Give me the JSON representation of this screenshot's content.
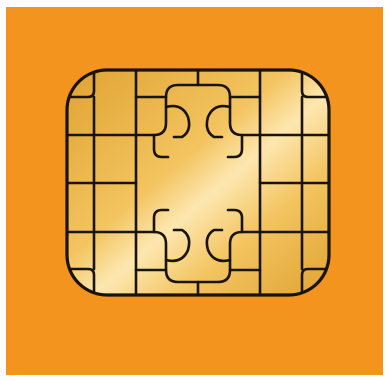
{
  "image": {
    "subject": "chip-icon",
    "colors": {
      "page_background": "#ffffff",
      "tile_background": "#f3941f",
      "chip_gold_dark": "#e0a332",
      "chip_gold_mid": "#f3c460",
      "chip_gold_light": "#fde7b0",
      "contact_lines": "#1a1308"
    }
  }
}
